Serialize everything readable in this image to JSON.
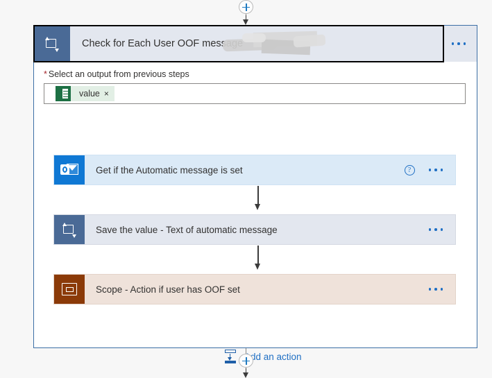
{
  "top_connector": {
    "add_button_icon": "plus-circle-icon",
    "arrow_icon": "arrow-down-icon"
  },
  "bottom_connector": {
    "add_button_icon": "plus-circle-icon",
    "arrow_icon": "arrow-down-icon"
  },
  "foreach_card": {
    "header": {
      "icon": "apply-to-each-loop-icon",
      "title": "Check for Each User OOF message",
      "redaction": "redacted-scribble",
      "menu_icon": "ellipsis-icon"
    },
    "field": {
      "required_marker": "*",
      "label": "Select an output from previous steps",
      "token": {
        "icon": "excel-icon",
        "text": "value",
        "remove_icon": "×"
      }
    },
    "actions": [
      {
        "icon": "outlook-icon",
        "title": "Get if the Automatic message is set",
        "help_icon": "?",
        "menu_icon": "ellipsis-icon",
        "theme": "bg-outlook",
        "icon_theme": "icon-outlook",
        "glyph": "outlook",
        "has_help": true
      },
      {
        "icon": "apply-to-each-loop-icon",
        "title": "Save the value - Text of automatic message",
        "menu_icon": "ellipsis-icon",
        "theme": "bg-loop",
        "icon_theme": "icon-foreach",
        "glyph": "loop",
        "has_help": false
      },
      {
        "icon": "scope-icon",
        "title": "Scope - Action if user has OOF set",
        "menu_icon": "ellipsis-icon",
        "theme": "bg-scope",
        "icon_theme": "icon-scope",
        "glyph": "scope",
        "has_help": false
      }
    ],
    "add_action": {
      "icon": "insert-action-icon",
      "label": "Add an action"
    }
  },
  "colors": {
    "canvas": "#f7f7f7",
    "card_border": "#3b6ea5",
    "header_bg": "#e3e7ef",
    "loop_icon_bg": "#4a6a96",
    "outlook_icon_bg": "#0f78d4",
    "scope_icon_bg": "#8b3a08",
    "outlook_card_bg": "#dbeaf7",
    "loop_card_bg": "#e3e7ef",
    "scope_card_bg": "#efe2da",
    "accent_blue": "#1f6fc4",
    "required_red": "#a4262c",
    "token_chip_bg": "#e2efe5",
    "token_icon_bg": "#1d7044"
  }
}
